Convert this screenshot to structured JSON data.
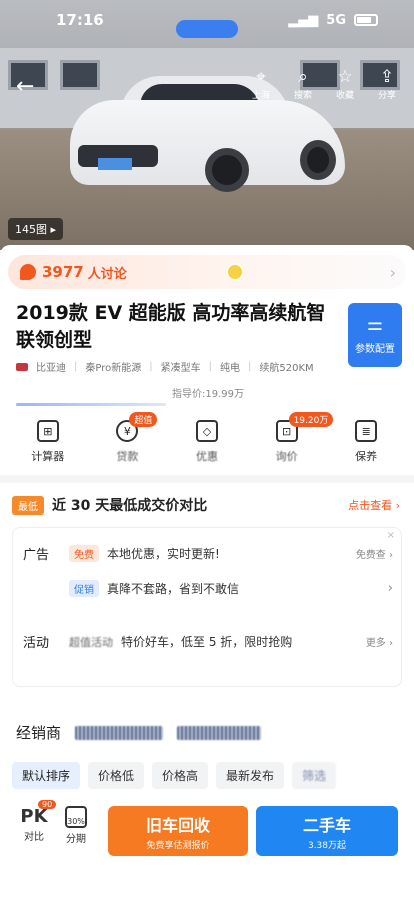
{
  "status_bar": {
    "time": "17:16",
    "network": "5G"
  },
  "hero": {
    "back_label": "←",
    "actions": [
      {
        "icon": "location-pin-icon",
        "glyph": "⌖",
        "label": "上海"
      },
      {
        "icon": "search-icon",
        "glyph": "⌕",
        "label": "搜索"
      },
      {
        "icon": "star-icon",
        "glyph": "☆",
        "label": "收藏"
      },
      {
        "icon": "share-icon",
        "glyph": "⇪",
        "label": "分享"
      }
    ],
    "photo_count": "145图 ▸"
  },
  "discussion": {
    "count": "3977",
    "label": "人讨论",
    "arrow": "›"
  },
  "title": "2019款 EV 超能版 高功率高续航智联领创型",
  "params_button": {
    "icon": "⚌",
    "label": "参数配置"
  },
  "meta": [
    "比亚迪",
    "秦Pro新能源",
    "紧凑型车",
    "纯电",
    "续航520KM"
  ],
  "guide_price": "指导价:19.99万",
  "icon_row": [
    {
      "icon": "calculator-icon",
      "glyph": "⊞",
      "label": "计算器",
      "badge": ""
    },
    {
      "icon": "loan-icon",
      "glyph": "¥",
      "label": "贷款",
      "badge": "超值"
    },
    {
      "icon": "coupon-icon",
      "glyph": "◇",
      "label": "优惠",
      "badge": ""
    },
    {
      "icon": "car-price-icon",
      "glyph": "⊡",
      "label": "询价",
      "badge": "19.20万"
    },
    {
      "icon": "maintenance-icon",
      "glyph": "≣",
      "label": "保养",
      "badge": ""
    }
  ],
  "compare": {
    "tag": "最低",
    "title": "近 30 天最低成交价对比",
    "link": "点击查看 ›"
  },
  "promo": {
    "close": "×",
    "ad_label": "广告",
    "ad_tag": "免费",
    "ad_text": "本地优惠，实时更新!",
    "ad_right": "免费查 ›",
    "sale_tag": "促销",
    "sale_text": "真降不套路，省到不敢信",
    "sale_right": "›",
    "activity_label": "活动",
    "activity_tag": "超值活动",
    "activity_text": "特价好车，低至 5 折，限时抢购",
    "activity_right": "更多 ›"
  },
  "dealer": {
    "label": "经销商"
  },
  "sort_chips": [
    "默认排序",
    "价格低",
    "价格高",
    "最新发布",
    "筛选"
  ],
  "bottom_bar": {
    "pk": {
      "label": "PK",
      "badge": "90",
      "caption": "对比"
    },
    "installment": {
      "label": "30%",
      "caption": "分期"
    },
    "trade_in": {
      "title": "旧车回收",
      "subtitle": "免费享估测报价"
    },
    "used_car": {
      "title": "二手车",
      "subtitle": "3.38万起"
    }
  },
  "colors": {
    "accent_orange": "#f2571e",
    "accent_blue": "#2f7cf0"
  }
}
